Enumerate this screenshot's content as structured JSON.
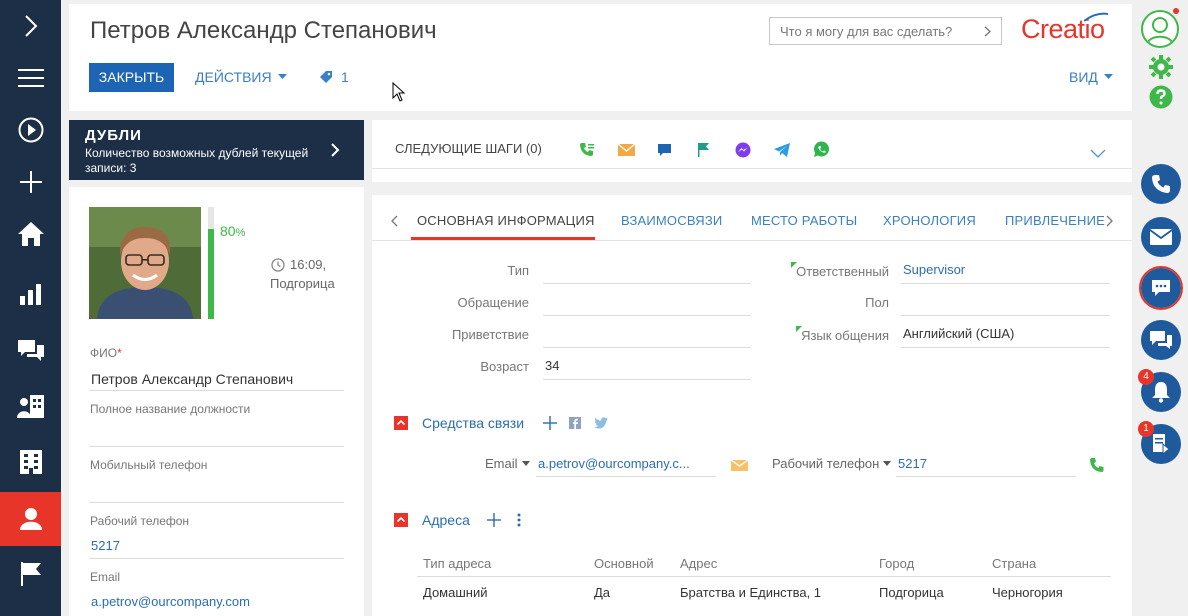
{
  "header": {
    "title": "Петров Александр Степанович",
    "close_label": "ЗАКРЫТЬ",
    "actions_label": "ДЕЙСТВИЯ",
    "tags_count": "1",
    "view_label": "ВИД",
    "search_placeholder": "Что я могу для вас сделать?",
    "logo": "Creatio"
  },
  "duplicates": {
    "title": "ДУБЛИ",
    "subtitle": "Количество возможных дублей текущей записи: 3"
  },
  "next_steps": {
    "label": "СЛЕДУЮЩИЕ ШАГИ (0)"
  },
  "profile": {
    "completeness": "80",
    "completeness_unit": "%",
    "completeness_fraction": 0.8,
    "local_time": "16:09,",
    "city": "Подгорица",
    "fields": [
      {
        "label": "ФИО",
        "value": "Петров Александр Степанович",
        "required": "*"
      },
      {
        "label": "Полное название должности",
        "value": ""
      },
      {
        "label": "Мобильный телефон",
        "value": ""
      },
      {
        "label": "Рабочий телефон",
        "value": "5217"
      },
      {
        "label": "Email",
        "value": "a.petrov@ourcompany.com"
      }
    ]
  },
  "tabs": [
    {
      "label": "ОСНОВНАЯ ИНФОРМАЦИЯ",
      "active": true
    },
    {
      "label": "ВЗАИМОСВЯЗИ"
    },
    {
      "label": "МЕСТО РАБОТЫ"
    },
    {
      "label": "ХРОНОЛОГИЯ"
    },
    {
      "label": "ПРИВЛЕЧЕНИЕ"
    }
  ],
  "main_info": {
    "left": [
      {
        "label": "Тип",
        "value": ""
      },
      {
        "label": "Обращение",
        "value": ""
      },
      {
        "label": "Приветствие",
        "value": ""
      },
      {
        "label": "Возраст",
        "value": "34"
      }
    ],
    "right": [
      {
        "label": "Ответственный",
        "value": "Supervisor"
      },
      {
        "label": "Пол",
        "value": ""
      },
      {
        "label": "Язык общения",
        "value": "Английский (США)"
      }
    ]
  },
  "communications": {
    "title": "Средства связи",
    "email_label": "Email",
    "email_value": "a.petrov@ourcompany.c...",
    "phone_label": "Рабочий телефон",
    "phone_value": "5217"
  },
  "addresses": {
    "title": "Адреса",
    "columns": [
      "Тип адреса",
      "Основной",
      "Адрес",
      "Город",
      "Страна"
    ],
    "rows": [
      [
        "Домашний",
        "Да",
        "Братства и Единства, 1",
        "Подгорица",
        "Черногория"
      ]
    ]
  },
  "rightbar": {
    "notifications_badge": "4",
    "processes_badge": "1"
  },
  "colors": {
    "nav_bg": "#1d2f47",
    "accent_red": "#e7352a",
    "primary_blue": "#1e5a9c",
    "link_blue": "#2b6db3",
    "green": "#3fb84a"
  }
}
